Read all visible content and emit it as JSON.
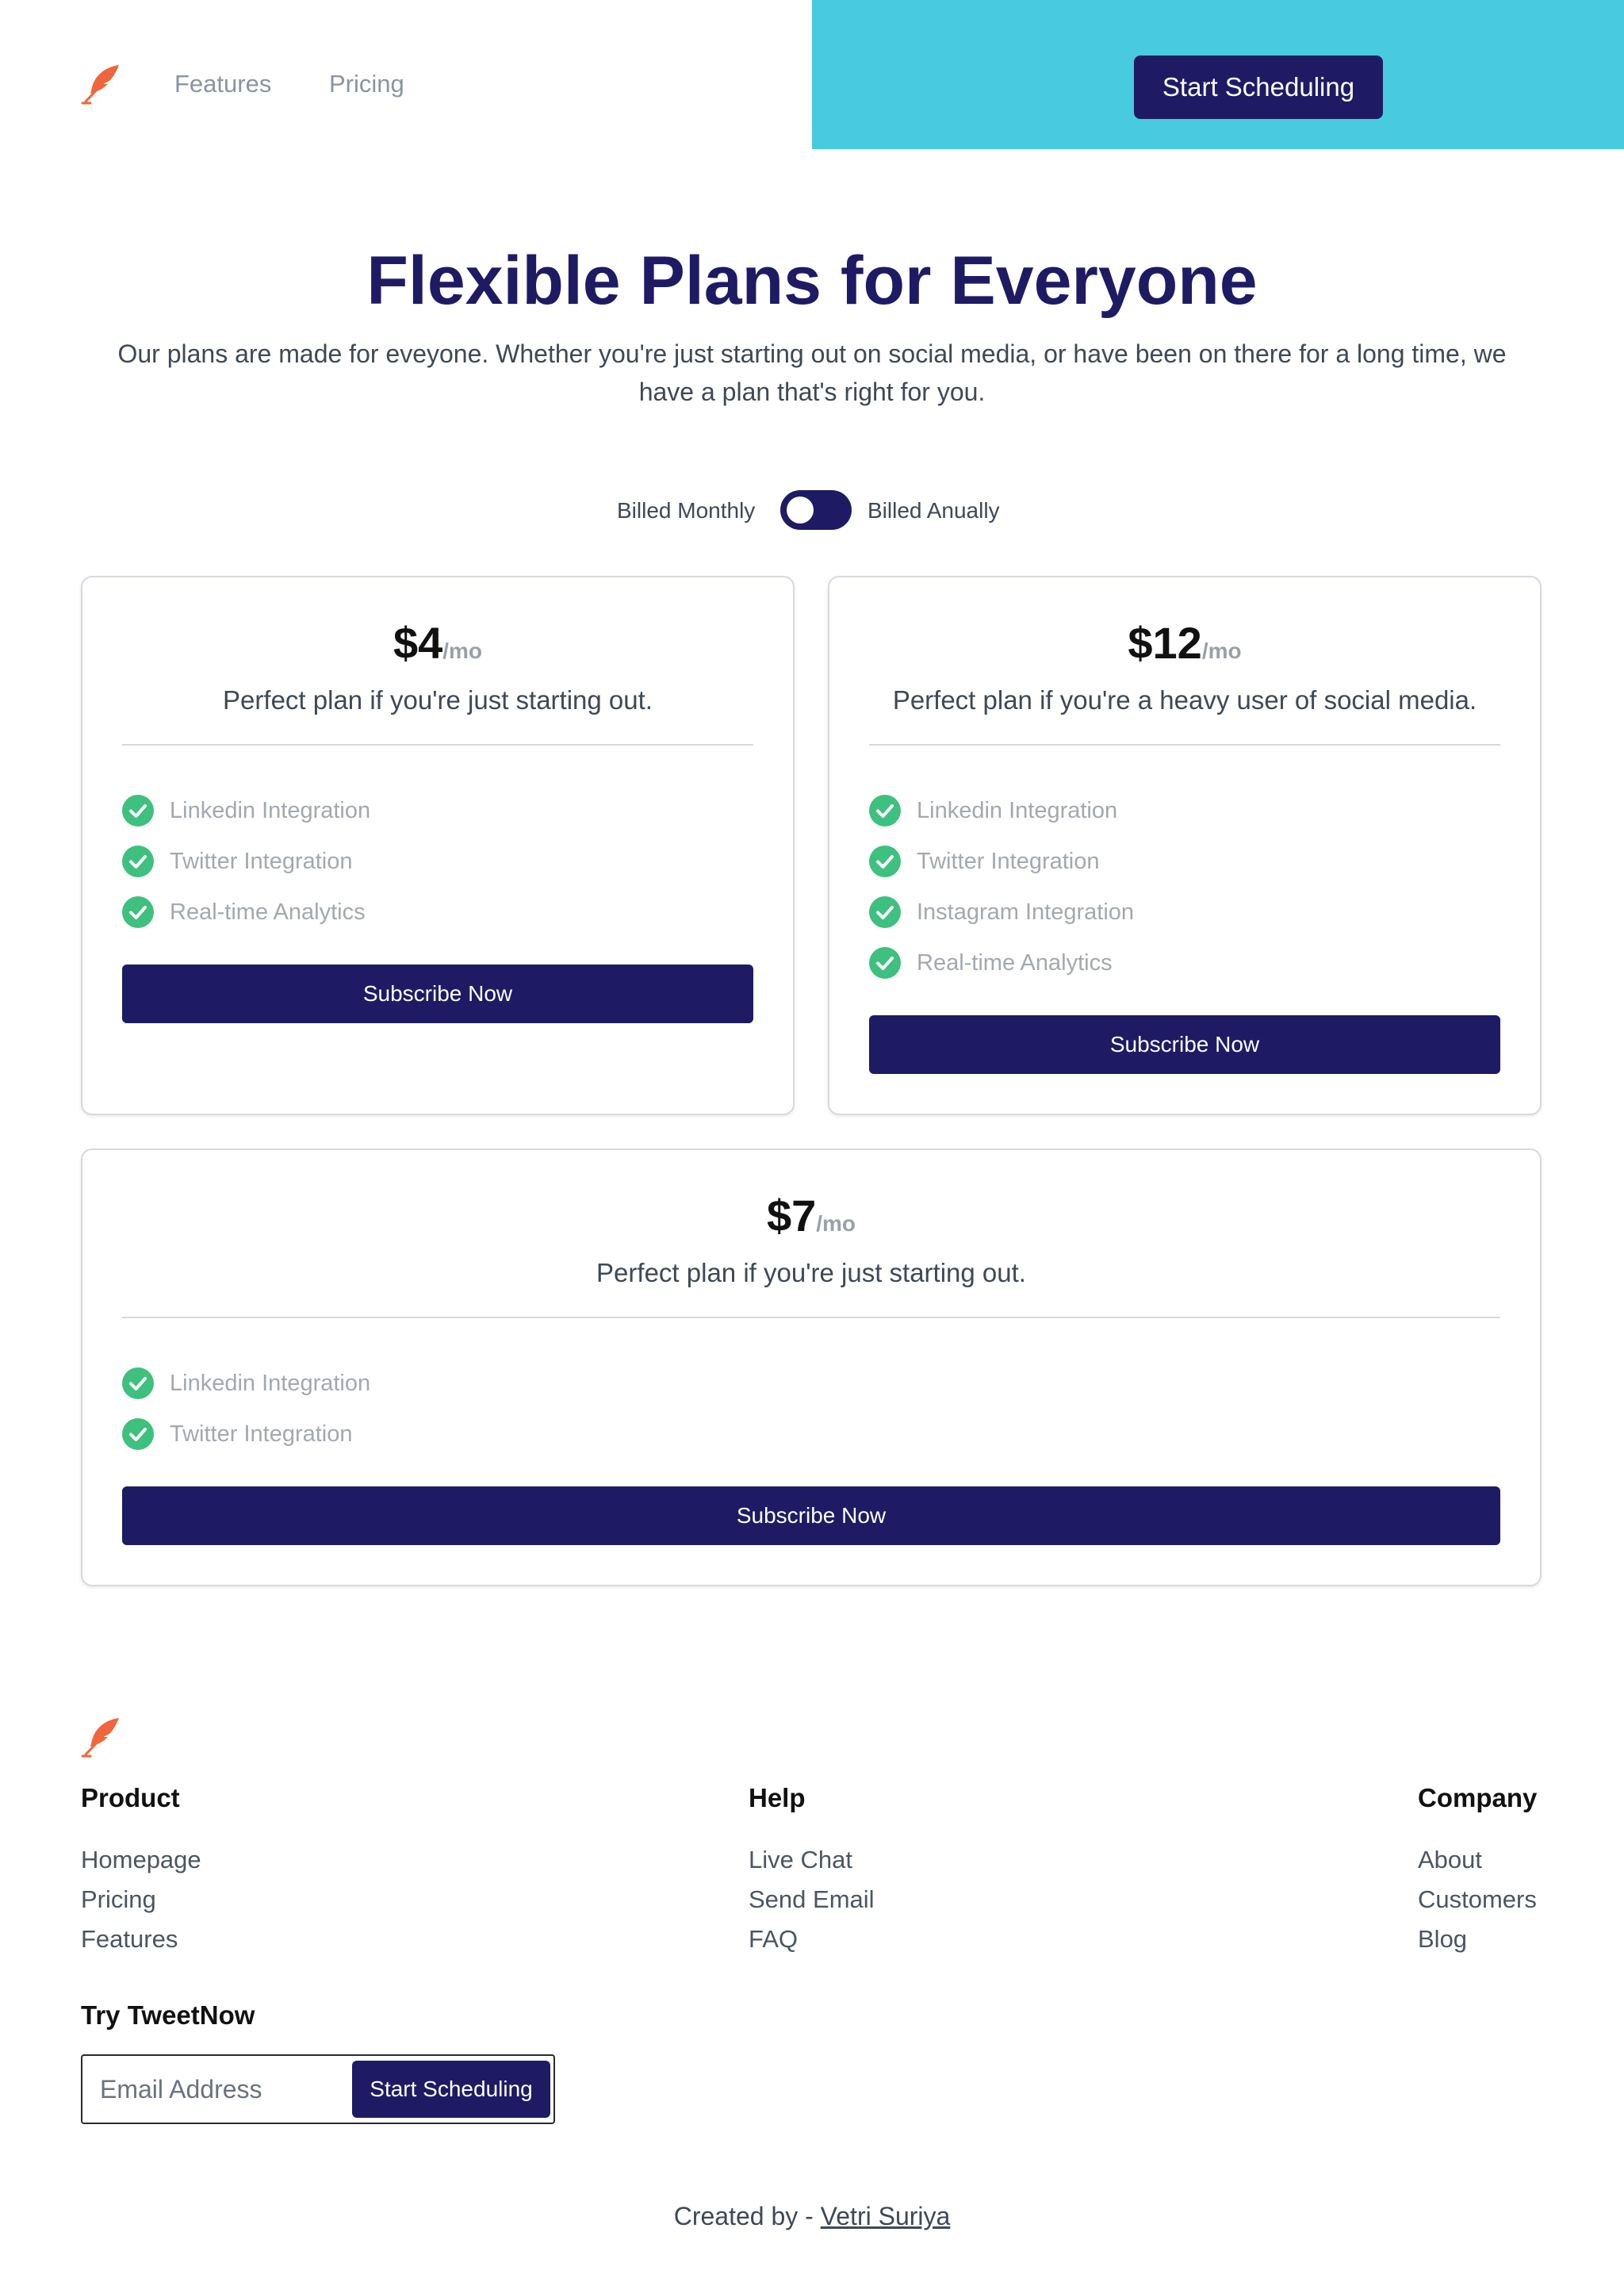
{
  "colors": {
    "brand_navy": "#1e1b64",
    "header_accent": "#48cae0",
    "check_green": "#3ec07e",
    "logo_orange": "#f0663c"
  },
  "header": {
    "logo_icon": "feather-icon",
    "nav": {
      "features": "Features",
      "pricing": "Pricing"
    },
    "cta_label": "Start Scheduling"
  },
  "hero": {
    "title": "Flexible Plans for Everyone",
    "subtitle": "Our plans are made for eveyone. Whether you're just starting out on social media, or have been on there for a long time, we have a plan that's right for you."
  },
  "billing": {
    "monthly_label": "Billed Monthly",
    "annually_label": "Billed Anually",
    "toggle_state": "off"
  },
  "plans": [
    {
      "price": "$4",
      "unit": "/mo",
      "description": "Perfect plan if you're just starting out.",
      "features": [
        "Linkedin Integration",
        "Twitter Integration",
        "Real-time Analytics"
      ],
      "button": "Subscribe Now"
    },
    {
      "price": "$12",
      "unit": "/mo",
      "description": "Perfect plan if you're a heavy user of social media.",
      "features": [
        "Linkedin Integration",
        "Twitter Integration",
        "Instagram Integration",
        "Real-time Analytics"
      ],
      "button": "Subscribe Now"
    },
    {
      "price": "$7",
      "unit": "/mo",
      "description": "Perfect plan if you're just starting out.",
      "features": [
        "Linkedin Integration",
        "Twitter Integration"
      ],
      "button": "Subscribe Now"
    }
  ],
  "footer": {
    "logo_icon": "feather-icon",
    "columns": [
      {
        "heading": "Product",
        "links": [
          "Homepage",
          "Pricing",
          "Features"
        ]
      },
      {
        "heading": "Help",
        "links": [
          "Live Chat",
          "Send Email",
          "FAQ"
        ]
      },
      {
        "heading": "Company",
        "links": [
          "About",
          "Customers",
          "Blog"
        ]
      }
    ],
    "try": {
      "heading": "Try TweetNow",
      "email_placeholder": "Email Address",
      "button": "Start Scheduling"
    },
    "credits": {
      "prefix": "Created by - ",
      "author": "Vetri Suriya"
    }
  }
}
